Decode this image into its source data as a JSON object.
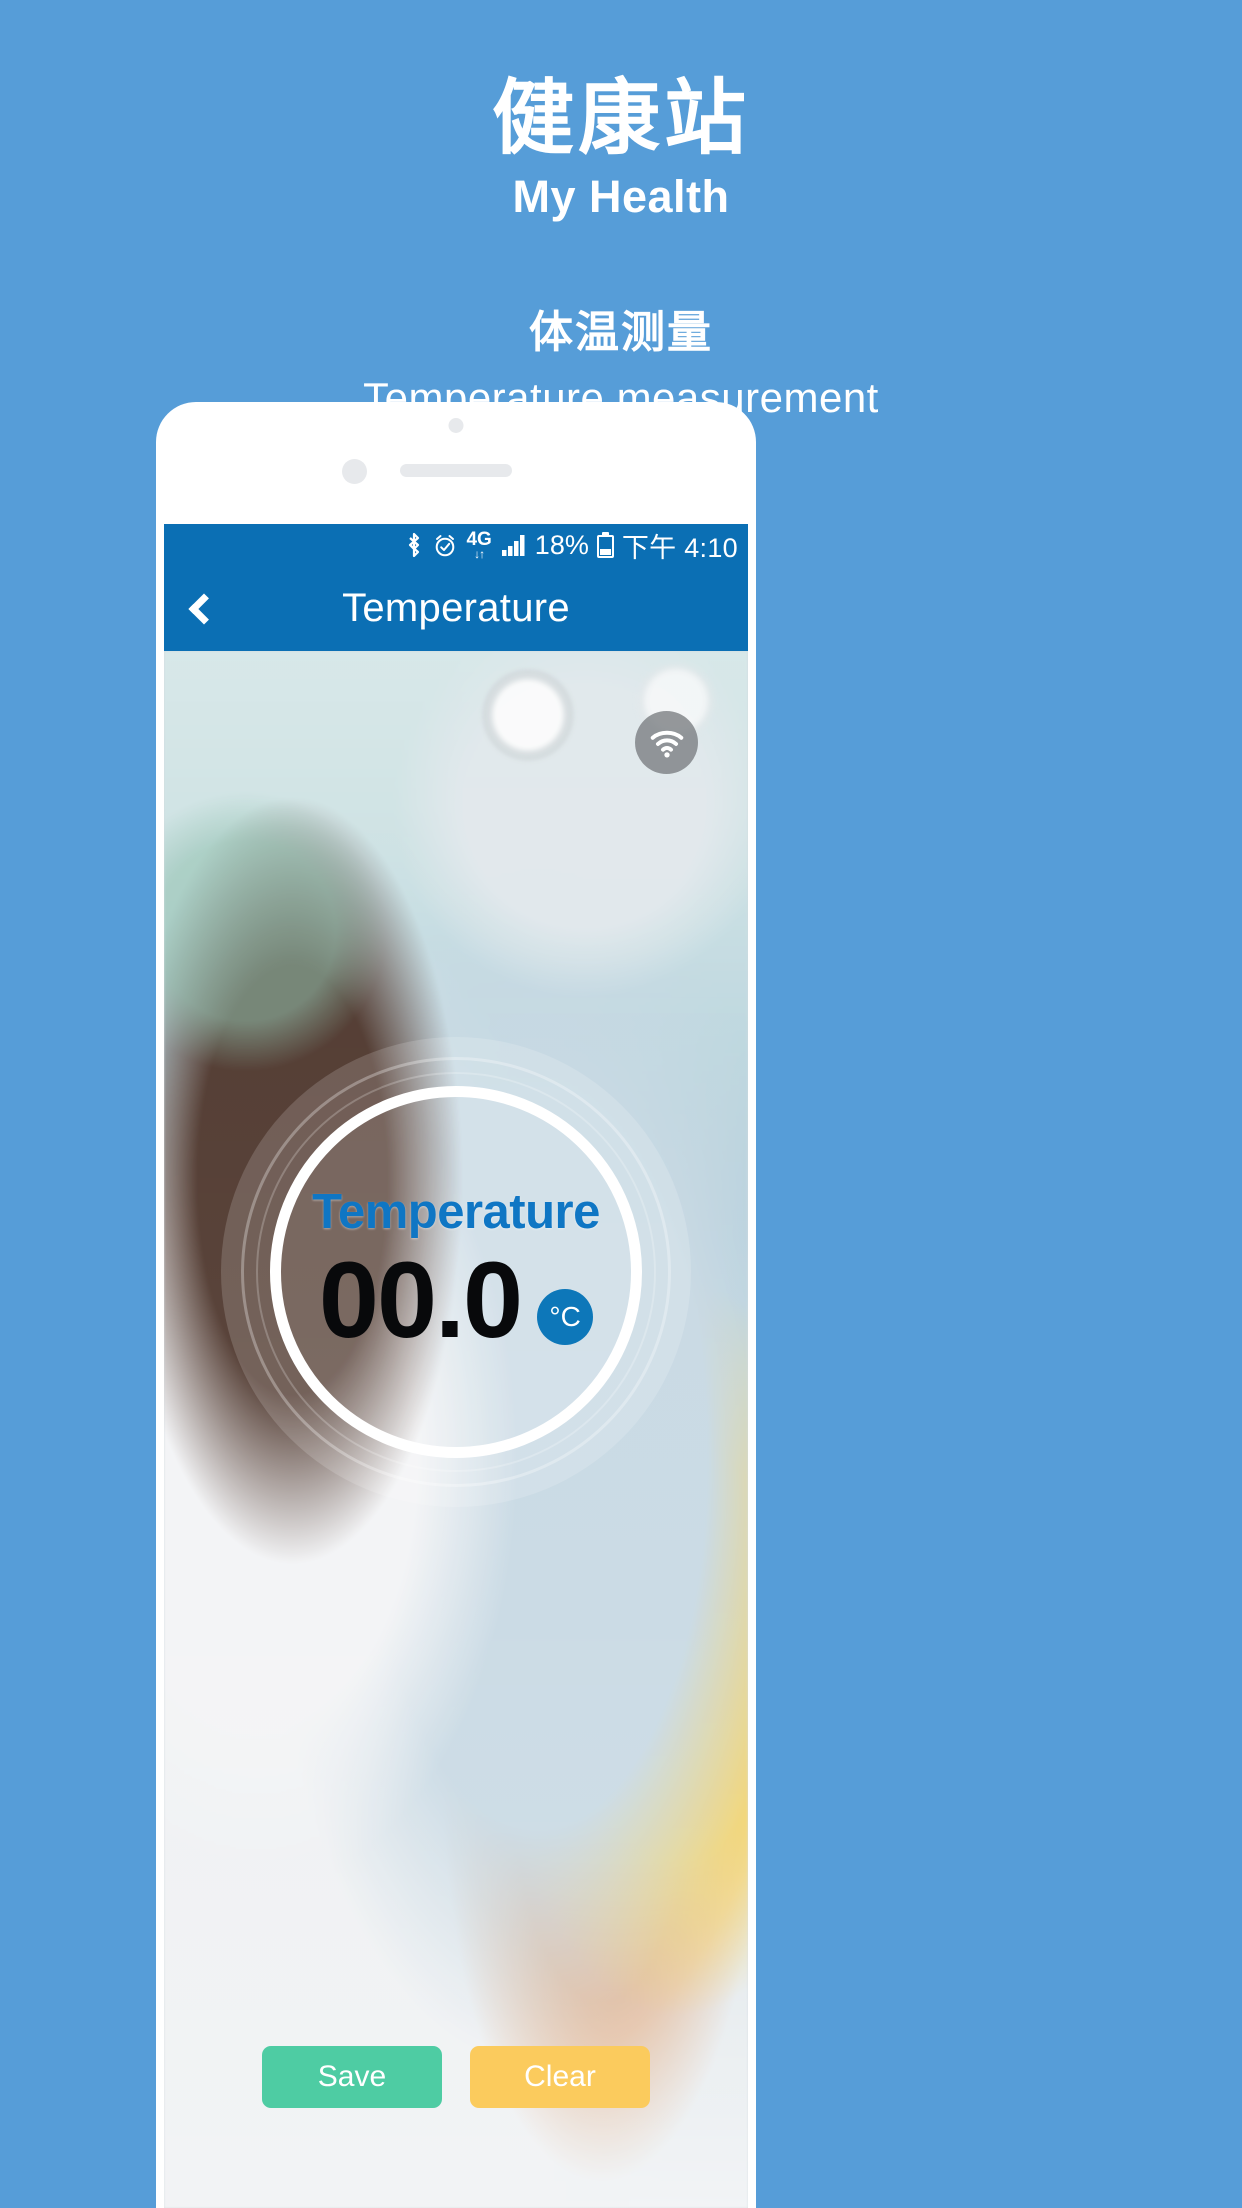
{
  "promo": {
    "brand_cn": "健康站",
    "brand_en": "My Health",
    "section_cn": "体温测量",
    "section_en": "Temperature measurement"
  },
  "phone": {
    "statusbar": {
      "bluetooth_icon": "bluetooth-icon",
      "alarm_icon": "alarm-icon",
      "network_label": "4G",
      "data_arrows": "↓↑",
      "signal_icon": "signal-bars-icon",
      "battery_percent": "18%",
      "battery_icon": "battery-icon",
      "time": "下午 4:10"
    },
    "appbar": {
      "back_icon": "back-chevron-icon",
      "title": "Temperature"
    },
    "content": {
      "wifi_icon": "wifi-icon",
      "dial": {
        "label": "Temperature",
        "value": "00.0",
        "unit": "°C"
      },
      "buttons": {
        "save": "Save",
        "clear": "Clear"
      }
    }
  },
  "colors": {
    "page_background": "#569dd8",
    "appbar": "#0b6fb4",
    "dial_label": "#0f76c4",
    "dial_value": "#08090b",
    "unit_badge": "#0d77b9",
    "save_button": "#4ecca3",
    "clear_button": "#fbcb5d",
    "text_on_brand": "#ffffff"
  }
}
